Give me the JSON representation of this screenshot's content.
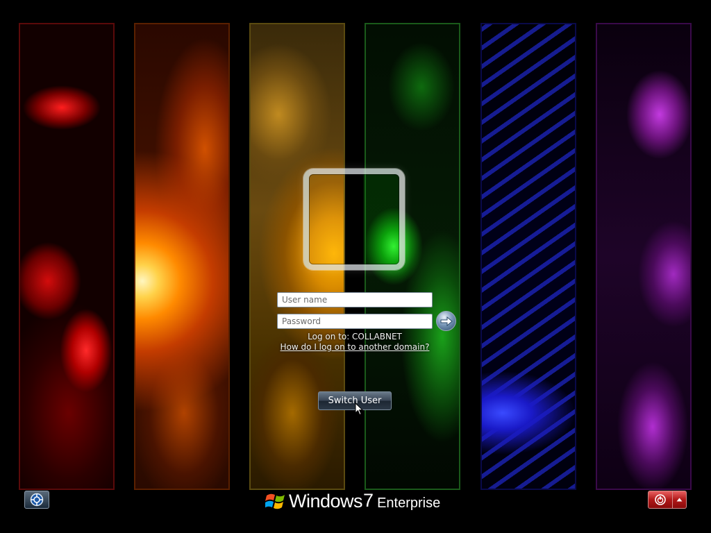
{
  "login": {
    "username_placeholder": "User name",
    "password_placeholder": "Password",
    "logon_to": "Log on to: COLLABNET",
    "domain_help_link": "How do I log on to another domain?",
    "switch_user_label": "Switch User"
  },
  "branding": {
    "product": "Windows",
    "version": "7",
    "edition": "Enterprise"
  },
  "icons": {
    "go": "arrow-right-icon",
    "ease_of_access": "ease-of-access-icon",
    "shutdown": "power-icon",
    "shutdown_options": "triangle-up-icon",
    "logo": "windows-flag-icon"
  },
  "colors": {
    "background": "#000000",
    "panels": [
      "#c00000",
      "#e06000",
      "#e0a000",
      "#10a010",
      "#2020e0",
      "#a020c0"
    ],
    "shutdown_button": "#b01818",
    "switch_user_button": "#2c3846"
  }
}
